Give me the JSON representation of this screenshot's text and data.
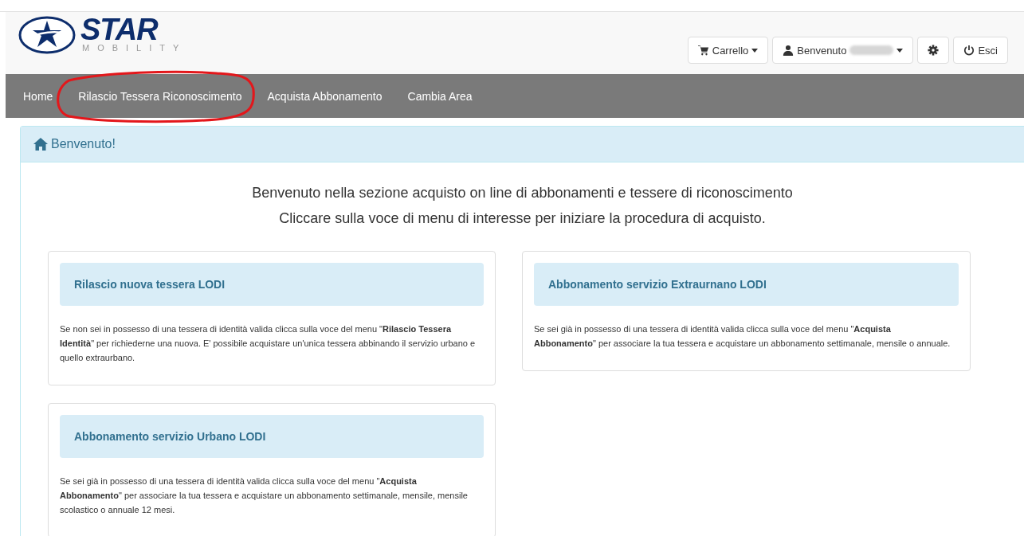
{
  "logo": {
    "name": "STAR",
    "tagline": "MOBILITY"
  },
  "header_buttons": [
    {
      "kind": "cart",
      "label": "Carrello",
      "dropdown": true,
      "redacted": false
    },
    {
      "kind": "user",
      "label": "Benvenuto",
      "dropdown": true,
      "redacted": true
    },
    {
      "kind": "settings",
      "dropdown": false,
      "redacted": false
    },
    {
      "kind": "logout",
      "label": "Esci",
      "dropdown": false,
      "redacted": false
    }
  ],
  "nav": [
    {
      "label": "Home",
      "circled": false
    },
    {
      "label": "Rilascio Tessera Riconoscimento",
      "circled": true
    },
    {
      "label": "Acquista Abbonamento",
      "circled": false
    },
    {
      "label": "Cambia Area",
      "circled": false
    }
  ],
  "panel": {
    "title": "Benvenuto!",
    "intro": [
      "Benvenuto nella sezione acquisto on line di abbonamenti e tessere di riconoscimento",
      "Cliccare sulla voce di menu di interesse per iniziare la procedura di acquisto."
    ],
    "cards": [
      {
        "title": "Rilascio nuova tessera LODI",
        "text": "Se non sei in possesso di una tessera di identità valida clicca sulla voce del menu \"**Rilascio Tessera Identità**\" per richiederne una nuova. E' possibile acquistare un'unica tessera abbinando il servizio urbano e quello extraurbano."
      },
      {
        "title": "Abbonamento servizio Extraurnano LODI",
        "text": "Se sei già in possesso di una tessera di identità valida clicca sulla voce del menu \"**Acquista Abbonamento**\" per associare la tua tessera e acquistare un abbonamento settimanale, mensile o annuale."
      },
      {
        "title": "Abbonamento servizio Urbano LODI",
        "text": "Se sei già in possesso di una tessera di identità valida clicca sulla voce del menu \"**Acquista Abbonamento**\" per associare la tua tessera e acquistare un abbonamento settimanale, mensile, mensile scolastico o annuale 12 mesi."
      }
    ]
  }
}
